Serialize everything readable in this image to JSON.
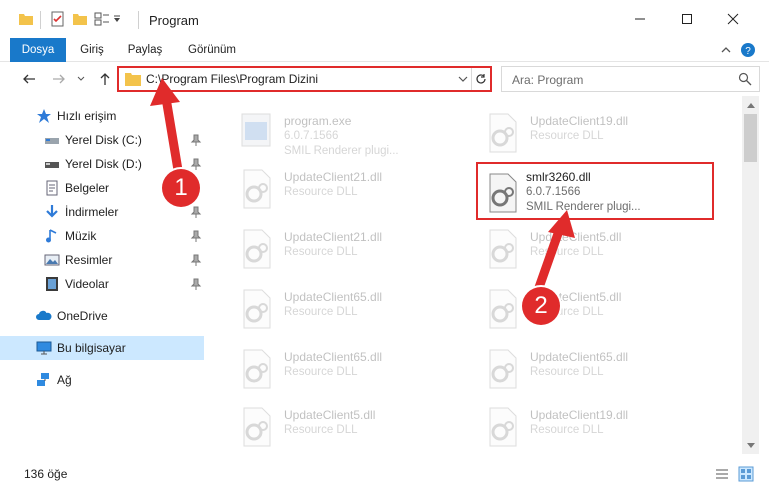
{
  "window": {
    "title": "Program",
    "minimize_icon": "minimize-icon",
    "maximize_icon": "maximize-icon",
    "close_icon": "close-icon"
  },
  "ribbon": {
    "tabs": [
      {
        "label": "Dosya",
        "active": true
      },
      {
        "label": "Giriş",
        "active": false
      },
      {
        "label": "Paylaş",
        "active": false
      },
      {
        "label": "Görünüm",
        "active": false
      }
    ]
  },
  "address": {
    "path": "C:\\Program Files\\Program Dizini",
    "search_placeholder": "Ara: Program"
  },
  "sidebar": {
    "quick_access": "Hızlı erişim",
    "items": [
      {
        "label": "Yerel Disk (C:)",
        "icon": "drive-icon",
        "pinned": true
      },
      {
        "label": "Yerel Disk (D:)",
        "icon": "drive-icon",
        "pinned": true
      },
      {
        "label": "Belgeler",
        "icon": "documents-icon",
        "pinned": true
      },
      {
        "label": "İndirmeler",
        "icon": "downloads-icon",
        "pinned": true
      },
      {
        "label": "Müzik",
        "icon": "music-icon",
        "pinned": true
      },
      {
        "label": "Resimler",
        "icon": "pictures-icon",
        "pinned": true
      },
      {
        "label": "Videolar",
        "icon": "videos-icon",
        "pinned": true
      }
    ],
    "onedrive": "OneDrive",
    "this_pc": "Bu bilgisayar",
    "network": "Ağ"
  },
  "files": {
    "left": [
      {
        "name": "program.exe",
        "version": "6.0.7.1566",
        "desc": "SMIL Renderer plugi..."
      },
      {
        "name": "UpdateClient21.dll",
        "version": "",
        "desc": "Resource DLL"
      },
      {
        "name": "UpdateClient21.dll",
        "version": "",
        "desc": "Resource DLL"
      },
      {
        "name": "UpdateClient65.dll",
        "version": "",
        "desc": "Resource DLL"
      },
      {
        "name": "UpdateClient65.dll",
        "version": "",
        "desc": "Resource DLL"
      },
      {
        "name": "UpdateClient5.dll",
        "version": "",
        "desc": "Resource DLL"
      }
    ],
    "right": [
      {
        "name": "UpdateClient19.dll",
        "version": "",
        "desc": "Resource DLL"
      },
      {
        "name": "smlr3260.dll",
        "version": "6.0.7.1566",
        "desc": "SMIL Renderer plugi..."
      },
      {
        "name": "UpdateClient5.dll",
        "version": "",
        "desc": "Resource DLL"
      },
      {
        "name": "UpdateClient5.dll",
        "version": "",
        "desc": "Resource DLL"
      },
      {
        "name": "UpdateClient65.dll",
        "version": "",
        "desc": "Resource DLL"
      },
      {
        "name": "UpdateClient19.dll",
        "version": "",
        "desc": "Resource DLL"
      }
    ]
  },
  "status": {
    "item_count": "136 öğe"
  },
  "annotations": {
    "step1": "1",
    "step2": "2",
    "color": "#e02b2b"
  },
  "colors": {
    "accent": "#1979ca",
    "selection": "#cce8ff"
  }
}
